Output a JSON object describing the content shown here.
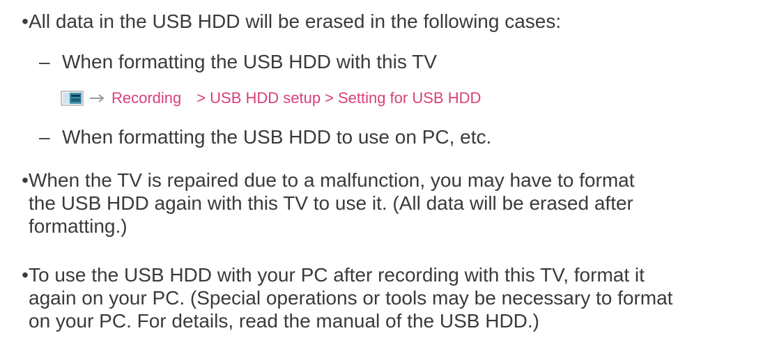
{
  "bullets": [
    {
      "lines": [
        "All data in the USB HDD will be erased in the following cases:"
      ],
      "subitems": [
        "When formatting the USB HDD with this TV",
        "When formatting the USB HDD to use on PC, etc."
      ]
    },
    {
      "lines": [
        "When the TV is repaired due to a malfunction, you may have to format",
        "the USB HDD again with this TV to use it. (All data will be erased after",
        "formatting.)"
      ]
    },
    {
      "lines": [
        "To use the USB HDD with your PC after recording with this TV, format it",
        "again on your PC. (Special operations or tools may be necessary to format",
        "on your PC. For details, read the manual of the USB HDD.)"
      ]
    }
  ],
  "bullet_char": "•",
  "dash_char": "–",
  "menu_path": {
    "icons": [
      "menu-icon",
      "arrow-right-icon"
    ],
    "items": [
      "Recording",
      "USB HDD setup",
      "Setting for USB HDD"
    ],
    "separator": ">",
    "color": "#d8407a"
  },
  "colors": {
    "text": "#3a3a3a",
    "link": "#d8407a",
    "icon_teal": "#3b8fa8",
    "icon_gray": "#9a9a9a"
  }
}
